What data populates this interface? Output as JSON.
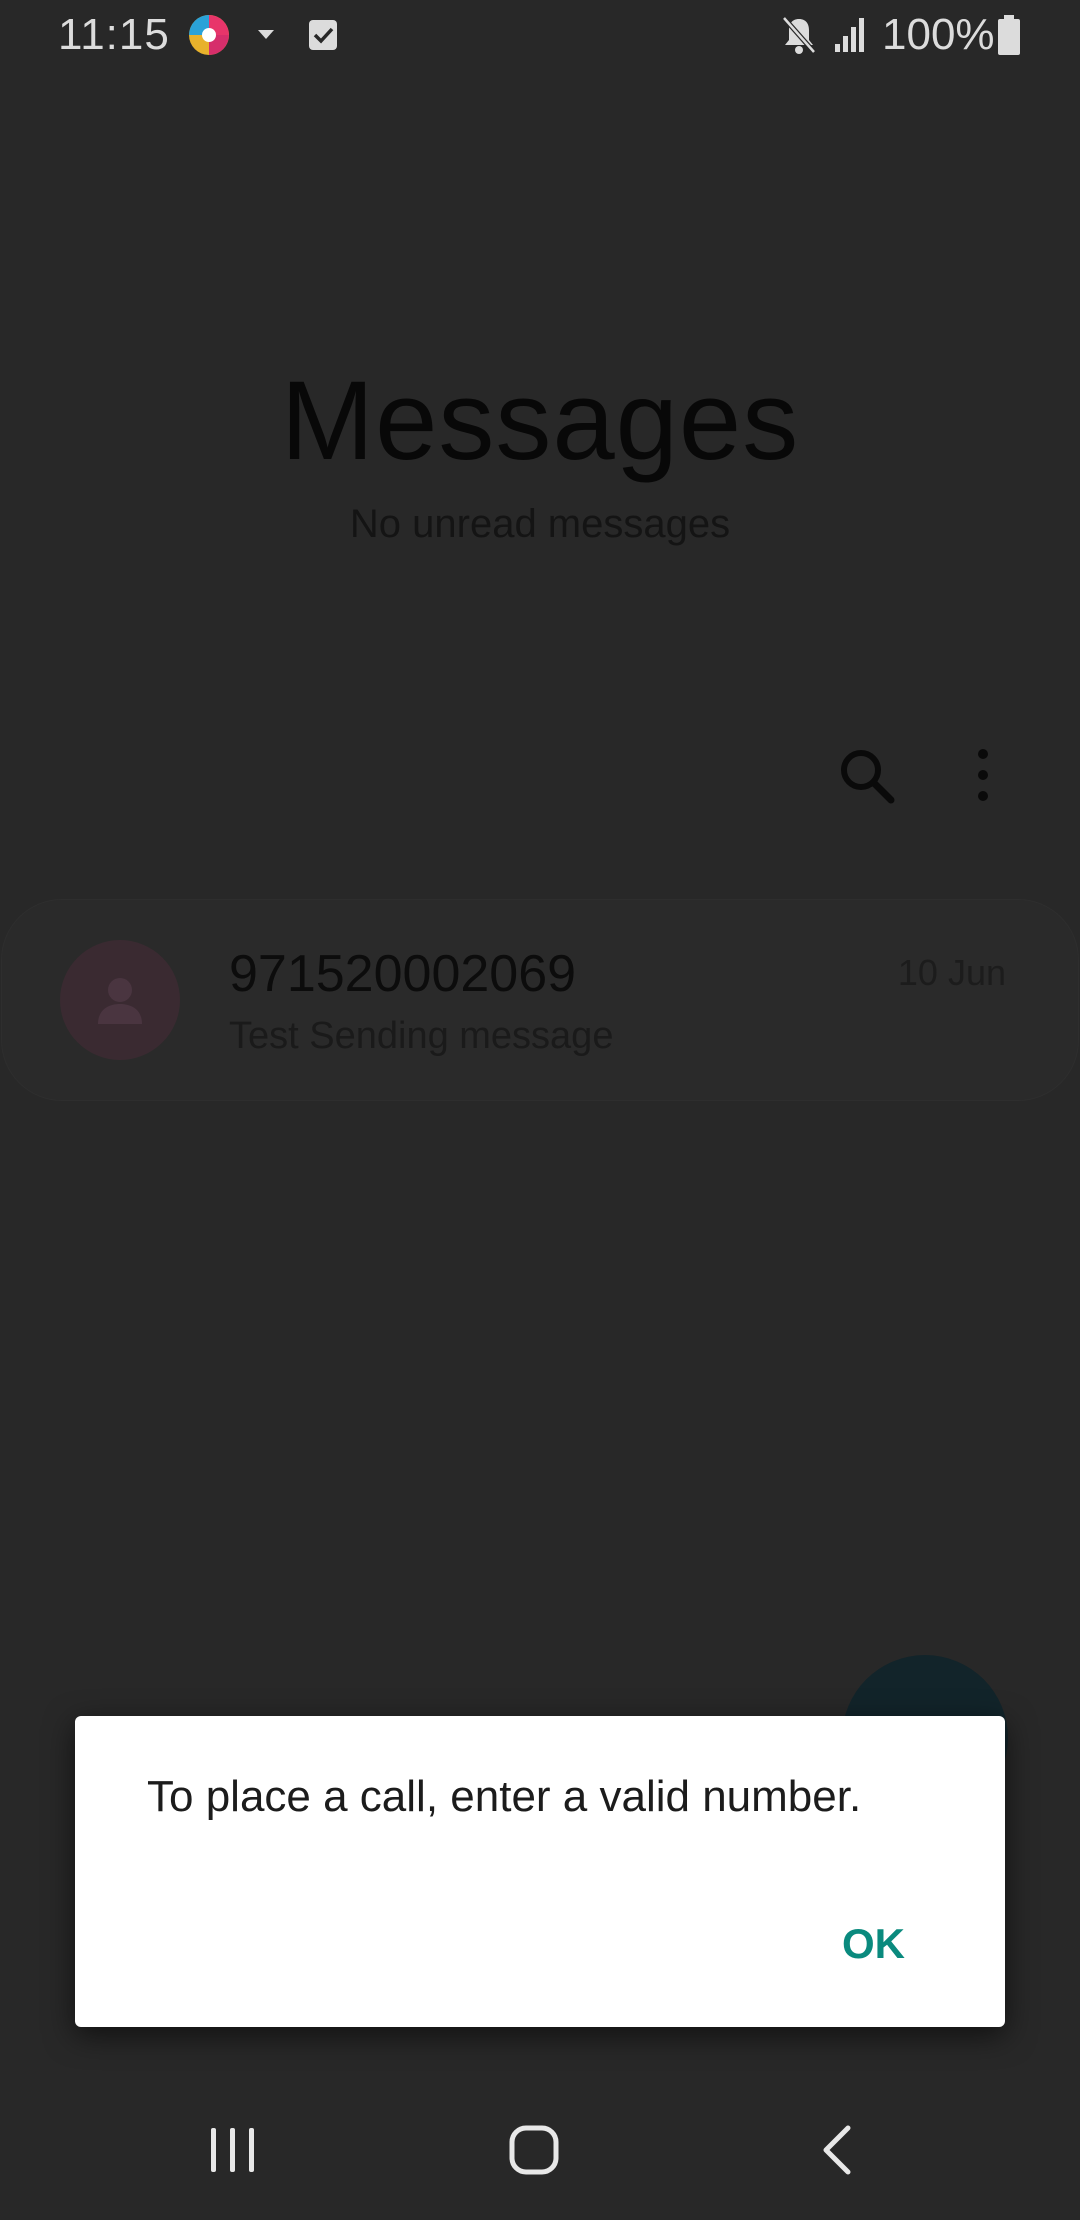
{
  "status_bar": {
    "time": "11:15",
    "battery_text": "100%",
    "icons": [
      "app-notification-icon",
      "caret-down-icon",
      "checkbox-notification-icon",
      "mute-icon",
      "signal-icon",
      "battery-icon"
    ]
  },
  "header": {
    "title": "Messages",
    "subtitle": "No unread messages"
  },
  "toolbar": {
    "icons": [
      "search-icon",
      "more-options-icon"
    ]
  },
  "conversations": [
    {
      "name": "971520002069",
      "preview": "Test Sending message",
      "date": "10 Jun"
    }
  ],
  "dialog": {
    "message": "To place a call, enter a valid number.",
    "ok_label": "OK",
    "accent_color": "#0a8a7e"
  },
  "nav_bar": {
    "icons": [
      "recent-apps-icon",
      "home-icon",
      "back-icon"
    ]
  },
  "colors": {
    "background": "#282828",
    "dialog_bg": "#ffffff"
  }
}
